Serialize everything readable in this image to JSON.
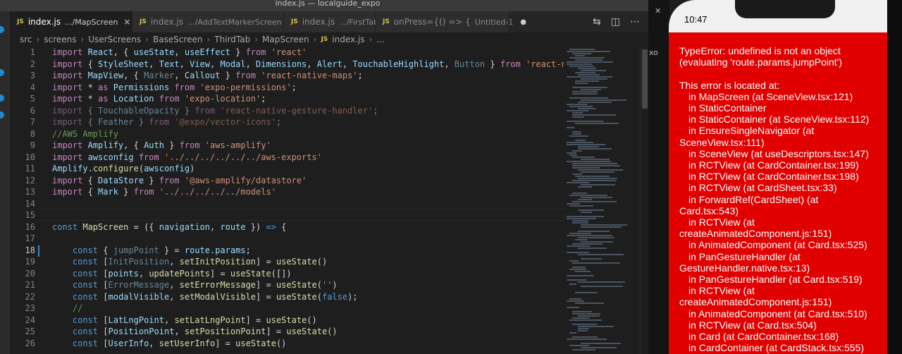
{
  "window_title": "index.js — localguide_expo",
  "tabs": [
    {
      "icon": "JS",
      "name": "index.js",
      "path": ".../MapScreen",
      "active": true,
      "close": "×"
    },
    {
      "icon": "JS",
      "name": "index.js",
      "path": ".../AddTextMarkerScreen"
    },
    {
      "icon": "JS",
      "name": "index.js",
      "path": ".../FirstTab"
    },
    {
      "icon": "JS",
      "name": "onPress={() => {",
      "path": "Untitled-1",
      "modified": "●"
    }
  ],
  "breadcrumb": [
    "src",
    "screens",
    "UserScreens",
    "BaseScreen",
    "ThirdTab",
    "MapScreen",
    "index.js",
    "..."
  ],
  "breadcrumb_icon": "JS",
  "code_lines": [
    {
      "n": "1",
      "t": [
        [
          "kw",
          "import "
        ],
        [
          "var",
          "React"
        ],
        [
          "p",
          ", { "
        ],
        [
          "var",
          "useState"
        ],
        [
          "p",
          ", "
        ],
        [
          "var",
          "useEffect"
        ],
        [
          "p",
          " } "
        ],
        [
          "kw",
          "from "
        ],
        [
          "str",
          "'react'"
        ]
      ]
    },
    {
      "n": "2",
      "t": [
        [
          "kw",
          "import "
        ],
        [
          "p",
          "{ "
        ],
        [
          "var",
          "StyleSheet"
        ],
        [
          "p",
          ", "
        ],
        [
          "var",
          "Text"
        ],
        [
          "p",
          ", "
        ],
        [
          "var",
          "View"
        ],
        [
          "p",
          ", "
        ],
        [
          "var",
          "Modal"
        ],
        [
          "p",
          ", "
        ],
        [
          "var",
          "Dimensions"
        ],
        [
          "p",
          ", "
        ],
        [
          "var",
          "Alert"
        ],
        [
          "p",
          ", "
        ],
        [
          "var",
          "TouchableHighlight"
        ],
        [
          "p",
          ", "
        ],
        [
          "dimvar",
          "Button"
        ],
        [
          "p",
          " } "
        ],
        [
          "kw",
          "from "
        ],
        [
          "str",
          "'react-native'"
        ],
        [
          "p",
          ";"
        ]
      ]
    },
    {
      "n": "3",
      "t": [
        [
          "kw",
          "import "
        ],
        [
          "var",
          "MapView"
        ],
        [
          "p",
          ", { "
        ],
        [
          "dimvar",
          "Marker"
        ],
        [
          "p",
          ", "
        ],
        [
          "var",
          "Callout"
        ],
        [
          "p",
          " } "
        ],
        [
          "kw",
          "from "
        ],
        [
          "str",
          "'react-native-maps'"
        ],
        [
          "p",
          ";"
        ]
      ]
    },
    {
      "n": "4",
      "t": [
        [
          "kw",
          "import "
        ],
        [
          "p",
          "* "
        ],
        [
          "kw",
          "as "
        ],
        [
          "var",
          "Permissions "
        ],
        [
          "kw",
          "from "
        ],
        [
          "str",
          "'expo-permissions'"
        ],
        [
          "p",
          ";"
        ]
      ]
    },
    {
      "n": "5",
      "t": [
        [
          "kw",
          "import "
        ],
        [
          "p",
          "* "
        ],
        [
          "kw",
          "as "
        ],
        [
          "var",
          "Location "
        ],
        [
          "kw",
          "from "
        ],
        [
          "str",
          "'expo-location'"
        ],
        [
          "p",
          ";"
        ]
      ]
    },
    {
      "n": "6",
      "t": [
        [
          "dimkw",
          "import "
        ],
        [
          "dim",
          "{ "
        ],
        [
          "dimvar",
          "TouchableOpacity"
        ],
        [
          "dim",
          " } "
        ],
        [
          "dimkw",
          "from "
        ],
        [
          "dimstr",
          "'react-native-gesture-handler'"
        ],
        [
          "dim",
          ";"
        ]
      ]
    },
    {
      "n": "7",
      "t": [
        [
          "dimkw",
          "import "
        ],
        [
          "dim",
          "{ "
        ],
        [
          "dimvar",
          "Feather"
        ],
        [
          "dim",
          " } "
        ],
        [
          "dimkw",
          "from "
        ],
        [
          "dimstr",
          "'@expo/vector-icons'"
        ],
        [
          "dim",
          ";"
        ]
      ]
    },
    {
      "n": "8",
      "t": [
        [
          "cm",
          "//AWS Amplify"
        ]
      ]
    },
    {
      "n": "9",
      "t": [
        [
          "kw",
          "import "
        ],
        [
          "var",
          "Amplify"
        ],
        [
          "p",
          ", { "
        ],
        [
          "var",
          "Auth"
        ],
        [
          "p",
          " } "
        ],
        [
          "kw",
          "from "
        ],
        [
          "str",
          "'aws-amplify'"
        ]
      ]
    },
    {
      "n": "10",
      "t": [
        [
          "kw",
          "import "
        ],
        [
          "var",
          "awsconfig "
        ],
        [
          "kw",
          "from "
        ],
        [
          "str",
          "'../../../../../../aws-exports'"
        ]
      ]
    },
    {
      "n": "11",
      "t": [
        [
          "var",
          "Amplify"
        ],
        [
          "p",
          "."
        ],
        [
          "fn",
          "configure"
        ],
        [
          "p",
          "("
        ],
        [
          "var",
          "awsconfig"
        ],
        [
          "p",
          ")"
        ]
      ]
    },
    {
      "n": "12",
      "t": [
        [
          "kw",
          "import "
        ],
        [
          "p",
          "{ "
        ],
        [
          "var",
          "DataStore"
        ],
        [
          "p",
          " } "
        ],
        [
          "kw",
          "from "
        ],
        [
          "str",
          "'@aws-amplify/datastore'"
        ]
      ]
    },
    {
      "n": "13",
      "t": [
        [
          "kw",
          "import "
        ],
        [
          "p",
          "{ "
        ],
        [
          "var",
          "Mark"
        ],
        [
          "p",
          " } "
        ],
        [
          "kw",
          "from "
        ],
        [
          "str",
          "'../../../../../models'"
        ]
      ]
    },
    {
      "n": "14",
      "t": []
    },
    {
      "n": "15",
      "t": []
    },
    {
      "n": "16",
      "t": [
        [
          "kb",
          "const "
        ],
        [
          "fn",
          "MapScreen"
        ],
        [
          "p",
          " = ({ "
        ],
        [
          "var",
          "navigation"
        ],
        [
          "p",
          ", "
        ],
        [
          "var",
          "route"
        ],
        [
          "p",
          " }) "
        ],
        [
          "kb",
          "=>"
        ],
        [
          "p",
          " {"
        ]
      ]
    },
    {
      "n": "17",
      "t": []
    },
    {
      "n": "18",
      "t": [
        [
          "p",
          "    "
        ],
        [
          "kb",
          "const "
        ],
        [
          "p",
          "{ "
        ],
        [
          "dimvar",
          "jumpPoint"
        ],
        [
          "p",
          " } = "
        ],
        [
          "var",
          "route"
        ],
        [
          "p",
          "."
        ],
        [
          "var",
          "params"
        ],
        [
          "p",
          ";"
        ]
      ]
    },
    {
      "n": "19",
      "t": [
        [
          "p",
          "    "
        ],
        [
          "kb",
          "const "
        ],
        [
          "p",
          "["
        ],
        [
          "dimvar",
          "InitPosition"
        ],
        [
          "p",
          ", "
        ],
        [
          "fn",
          "setInitPosition"
        ],
        [
          "p",
          "] = "
        ],
        [
          "fn",
          "useState"
        ],
        [
          "p",
          "()"
        ]
      ]
    },
    {
      "n": "20",
      "t": [
        [
          "p",
          "    "
        ],
        [
          "kb",
          "const "
        ],
        [
          "p",
          "["
        ],
        [
          "var",
          "points"
        ],
        [
          "p",
          ", "
        ],
        [
          "fn",
          "updatePoints"
        ],
        [
          "p",
          "] = "
        ],
        [
          "fn",
          "useState"
        ],
        [
          "p",
          "([])"
        ]
      ]
    },
    {
      "n": "21",
      "t": [
        [
          "p",
          "    "
        ],
        [
          "kb",
          "const "
        ],
        [
          "p",
          "["
        ],
        [
          "dimvar",
          "ErrorMessage"
        ],
        [
          "p",
          ", "
        ],
        [
          "fn",
          "setErrorMessage"
        ],
        [
          "p",
          "] = "
        ],
        [
          "fn",
          "useState"
        ],
        [
          "p",
          "("
        ],
        [
          "str",
          "''"
        ],
        [
          "p",
          ")"
        ]
      ]
    },
    {
      "n": "22",
      "t": [
        [
          "p",
          "    "
        ],
        [
          "kb",
          "const "
        ],
        [
          "p",
          "["
        ],
        [
          "var",
          "modalVisible"
        ],
        [
          "p",
          ", "
        ],
        [
          "fn",
          "setModalVisible"
        ],
        [
          "p",
          "] = "
        ],
        [
          "fn",
          "useState"
        ],
        [
          "p",
          "("
        ],
        [
          "kb",
          "false"
        ],
        [
          "p",
          ");"
        ]
      ]
    },
    {
      "n": "23",
      "t": [
        [
          "p",
          "    "
        ],
        [
          "cm",
          "//"
        ]
      ]
    },
    {
      "n": "24",
      "t": [
        [
          "p",
          "    "
        ],
        [
          "kb",
          "const "
        ],
        [
          "p",
          "["
        ],
        [
          "var",
          "LatLngPoint"
        ],
        [
          "p",
          ", "
        ],
        [
          "fn",
          "setLatLngPoint"
        ],
        [
          "p",
          "] = "
        ],
        [
          "fn",
          "useState"
        ],
        [
          "p",
          "()"
        ]
      ]
    },
    {
      "n": "25",
      "t": [
        [
          "p",
          "    "
        ],
        [
          "kb",
          "const "
        ],
        [
          "p",
          "["
        ],
        [
          "var",
          "PositionPoint"
        ],
        [
          "p",
          ", "
        ],
        [
          "fn",
          "setPositionPoint"
        ],
        [
          "p",
          "] = "
        ],
        [
          "fn",
          "useState"
        ],
        [
          "p",
          "()"
        ]
      ]
    },
    {
      "n": "26",
      "t": [
        [
          "p",
          "    "
        ],
        [
          "kb",
          "const "
        ],
        [
          "p",
          "["
        ],
        [
          "var",
          "UserInfo"
        ],
        [
          "p",
          ", "
        ],
        [
          "fn",
          "setUserInfo"
        ],
        [
          "p",
          "] = "
        ],
        [
          "fn",
          "useState"
        ],
        [
          "p",
          "()"
        ]
      ]
    }
  ],
  "phone": {
    "time": "10:47",
    "error_lines": [
      {
        "t": "TypeError: undefined is not an object",
        "i": false
      },
      {
        "t": "(evaluating 'route.params.jumpPoint')",
        "i": false
      },
      {
        "t": "",
        "i": false
      },
      {
        "t": "This error is located at:",
        "i": false
      },
      {
        "t": "in MapScreen (at SceneView.tsx:121)",
        "i": true
      },
      {
        "t": "in StaticContainer",
        "i": true
      },
      {
        "t": "in StaticContainer (at SceneView.tsx:112)",
        "i": true
      },
      {
        "t": "in EnsureSingleNavigator (at",
        "i": true
      },
      {
        "t": "SceneView.tsx:111)",
        "i": false
      },
      {
        "t": "in SceneView (at useDescriptors.tsx:147)",
        "i": true
      },
      {
        "t": "in RCTView (at CardContainer.tsx:199)",
        "i": true
      },
      {
        "t": "in RCTView (at CardContainer.tsx:198)",
        "i": true
      },
      {
        "t": "in RCTView (at CardSheet.tsx:33)",
        "i": true
      },
      {
        "t": "in ForwardRef(CardSheet) (at",
        "i": true
      },
      {
        "t": "Card.tsx:543)",
        "i": false
      },
      {
        "t": "in RCTView (at",
        "i": true
      },
      {
        "t": "createAnimatedComponent.js:151)",
        "i": false
      },
      {
        "t": "in AnimatedComponent (at Card.tsx:525)",
        "i": true
      },
      {
        "t": "in PanGestureHandler (at",
        "i": true
      },
      {
        "t": "GestureHandler.native.tsx:13)",
        "i": false
      },
      {
        "t": "in PanGestureHandler (at Card.tsx:519)",
        "i": true
      },
      {
        "t": "in RCTView (at",
        "i": true
      },
      {
        "t": "createAnimatedComponent.js:151)",
        "i": false
      },
      {
        "t": "in AnimatedComponent (at Card.tsx:510)",
        "i": true
      },
      {
        "t": "in RCTView (at Card.tsx:504)",
        "i": true
      },
      {
        "t": "in Card (at CardContainer.tsx:168)",
        "i": true
      },
      {
        "t": "in CardContainer (at CardStack.tsx:555)",
        "i": true
      }
    ]
  },
  "gap_text": "xo",
  "icons": {
    "compare": "compare-icon",
    "split": "split-editor-icon",
    "more": "more-actions-icon"
  }
}
